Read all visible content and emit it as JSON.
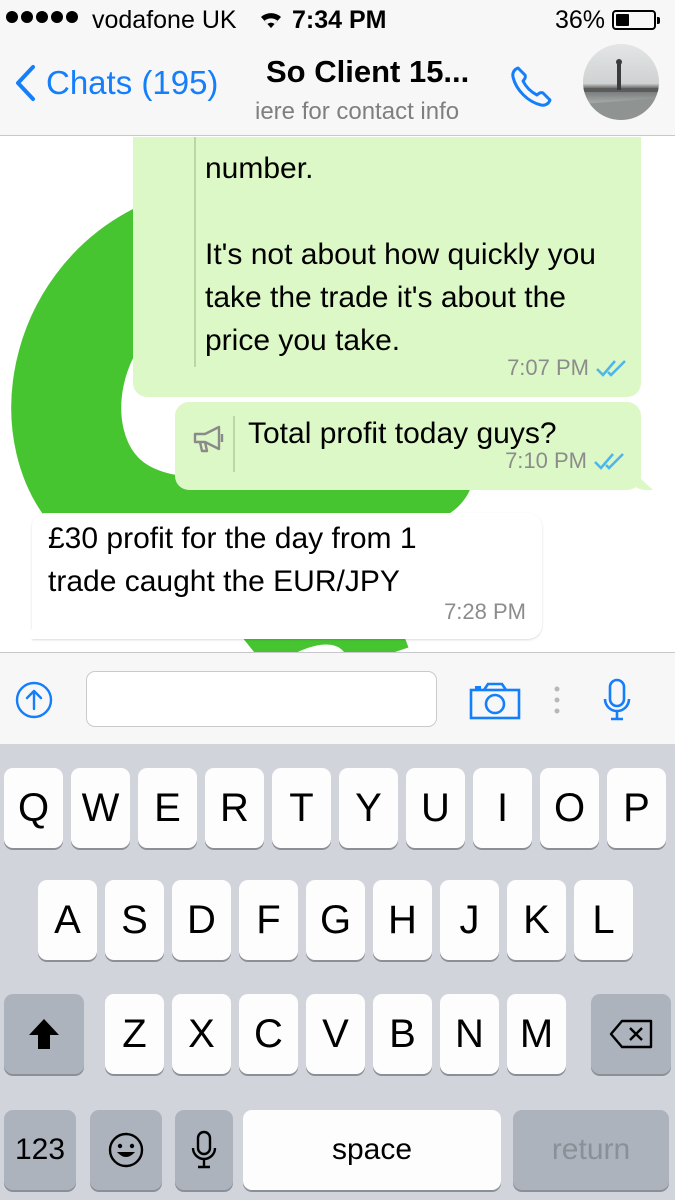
{
  "status_bar": {
    "carrier": "vodafone UK",
    "time": "7:34 PM",
    "battery": "36%",
    "battery_level": 0.36
  },
  "nav": {
    "back_label": "Chats (195)",
    "title": "So Client 15...",
    "subtitle": "iere for contact info"
  },
  "messages": [
    {
      "direction": "outgoing",
      "text": "number.\n\nIt's not about how quickly you take the trade it's about the price you take.",
      "time": "7:07 PM",
      "status": "read"
    },
    {
      "direction": "outgoing",
      "text": "Total profit today guys?",
      "time": "7:10 PM",
      "status": "read",
      "icon": "megaphone-icon"
    },
    {
      "direction": "incoming",
      "text": "£30 profit for the day from 1\ntrade caught the EUR/JPY",
      "time": "7:28 PM"
    }
  ],
  "input": {
    "value": "",
    "placeholder": ""
  },
  "keyboard": {
    "row1": [
      "Q",
      "W",
      "E",
      "R",
      "T",
      "Y",
      "U",
      "I",
      "O",
      "P"
    ],
    "row2": [
      "A",
      "S",
      "D",
      "F",
      "G",
      "H",
      "J",
      "K",
      "L"
    ],
    "row3": [
      "Z",
      "X",
      "C",
      "V",
      "B",
      "N",
      "M"
    ],
    "numbers_label": "123",
    "space_label": "space",
    "return_label": "return"
  },
  "colors": {
    "ios_blue": "#157efb",
    "outgoing_bubble": "#dcf8c6",
    "read_ticks": "#4fb6ec",
    "wallpaper_green": "#47c530",
    "keyboard_bg": "#d1d5db"
  }
}
